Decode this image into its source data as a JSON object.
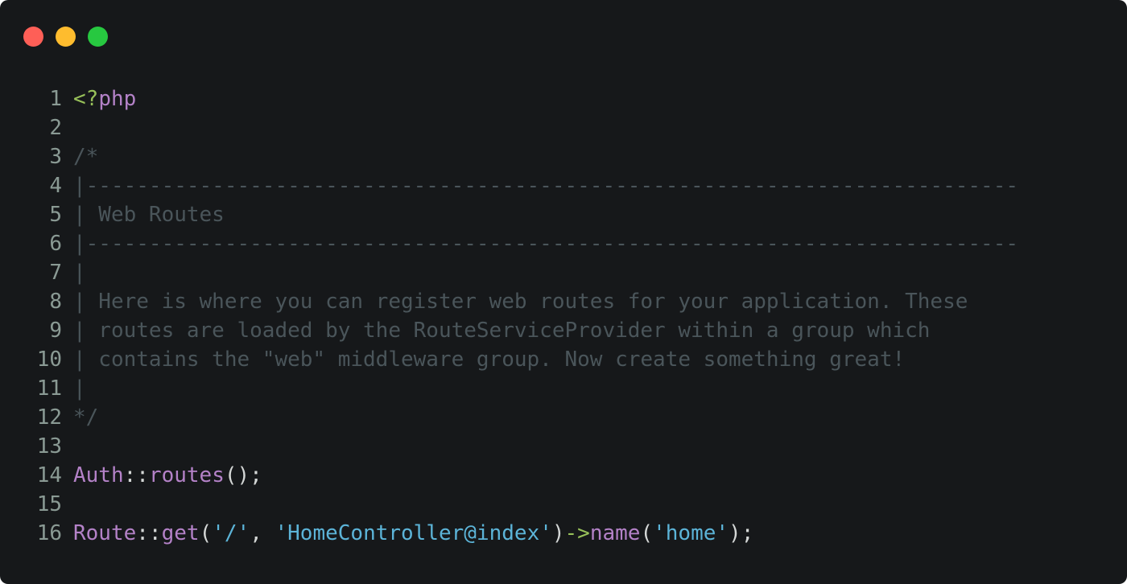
{
  "window": {
    "background": "#16181a",
    "traffic_lights": [
      {
        "name": "close",
        "color": "#fe5f57"
      },
      {
        "name": "minimize",
        "color": "#febc2e"
      },
      {
        "name": "zoom",
        "color": "#27c840"
      }
    ]
  },
  "colors": {
    "line_number": "#8a9a94",
    "default": "#d4d7d6",
    "comment": "#4a555a",
    "php_open_tag": "#98c15a",
    "keyword": "#b482c8",
    "class": "#b482c8",
    "method": "#b482c8",
    "string": "#5cb4d8",
    "arrow": "#98c15a",
    "punct": "#d4d7d6"
  },
  "code_lines": [
    {
      "number": "1",
      "tokens": [
        {
          "text": "<?",
          "kind": "php_open_tag"
        },
        {
          "text": "php",
          "kind": "keyword"
        }
      ]
    },
    {
      "number": "2",
      "tokens": []
    },
    {
      "number": "3",
      "tokens": [
        {
          "text": "/*",
          "kind": "comment"
        }
      ]
    },
    {
      "number": "4",
      "tokens": [
        {
          "text": "|--------------------------------------------------------------------------",
          "kind": "comment"
        }
      ]
    },
    {
      "number": "5",
      "tokens": [
        {
          "text": "| Web Routes",
          "kind": "comment"
        }
      ]
    },
    {
      "number": "6",
      "tokens": [
        {
          "text": "|--------------------------------------------------------------------------",
          "kind": "comment"
        }
      ]
    },
    {
      "number": "7",
      "tokens": [
        {
          "text": "|",
          "kind": "comment"
        }
      ]
    },
    {
      "number": "8",
      "tokens": [
        {
          "text": "| Here is where you can register web routes for your application. These",
          "kind": "comment"
        }
      ]
    },
    {
      "number": "9",
      "tokens": [
        {
          "text": "| routes are loaded by the RouteServiceProvider within a group which",
          "kind": "comment"
        }
      ]
    },
    {
      "number": "10",
      "tokens": [
        {
          "text": "| contains the \"web\" middleware group. Now create something great!",
          "kind": "comment"
        }
      ]
    },
    {
      "number": "11",
      "tokens": [
        {
          "text": "|",
          "kind": "comment"
        }
      ]
    },
    {
      "number": "12",
      "tokens": [
        {
          "text": "*/",
          "kind": "comment"
        }
      ]
    },
    {
      "number": "13",
      "tokens": []
    },
    {
      "number": "14",
      "tokens": [
        {
          "text": "Auth",
          "kind": "class"
        },
        {
          "text": "::",
          "kind": "punct"
        },
        {
          "text": "routes",
          "kind": "method"
        },
        {
          "text": "();",
          "kind": "punct"
        }
      ]
    },
    {
      "number": "15",
      "tokens": []
    },
    {
      "number": "16",
      "tokens": [
        {
          "text": "Route",
          "kind": "class"
        },
        {
          "text": "::",
          "kind": "punct"
        },
        {
          "text": "get",
          "kind": "method"
        },
        {
          "text": "(",
          "kind": "punct"
        },
        {
          "text": "'/'",
          "kind": "string"
        },
        {
          "text": ", ",
          "kind": "punct"
        },
        {
          "text": "'HomeController@index'",
          "kind": "string"
        },
        {
          "text": ")",
          "kind": "punct"
        },
        {
          "text": "->",
          "kind": "arrow"
        },
        {
          "text": "name",
          "kind": "method"
        },
        {
          "text": "(",
          "kind": "punct"
        },
        {
          "text": "'home'",
          "kind": "string"
        },
        {
          "text": ");",
          "kind": "punct"
        }
      ]
    }
  ]
}
